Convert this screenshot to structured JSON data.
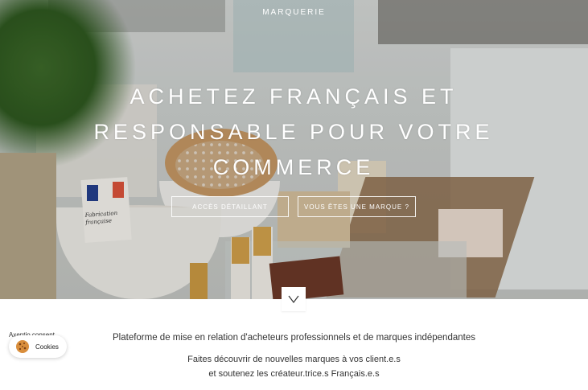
{
  "header": {
    "brand": "MARQUERIE"
  },
  "hero": {
    "headline": "ACHETEZ FRANÇAIS ET RESPONSABLE POUR VOTRE COMMERCE",
    "card_text": "Fabrication française",
    "buttons": {
      "retailer": "ACCÈS DÉTAILLANT",
      "brand": "VOUS ÊTES UNE MARQUE ?"
    },
    "scroll_icon": "chevron-down-icon"
  },
  "intro": {
    "tagline": "Plateforme de mise en relation d'acheteurs professionnels et de marques indépendantes",
    "line1": "Faites découvrir de nouvelles marques à vos client.e.s",
    "line2": "et soutenez les créateur.trice.s Français.e.s"
  },
  "consent": {
    "label": "Axeptio consent",
    "button": "Cookies",
    "icon": "cookie-icon"
  },
  "colors": {
    "text_dark": "#333333",
    "hero_text": "#ffffff"
  }
}
